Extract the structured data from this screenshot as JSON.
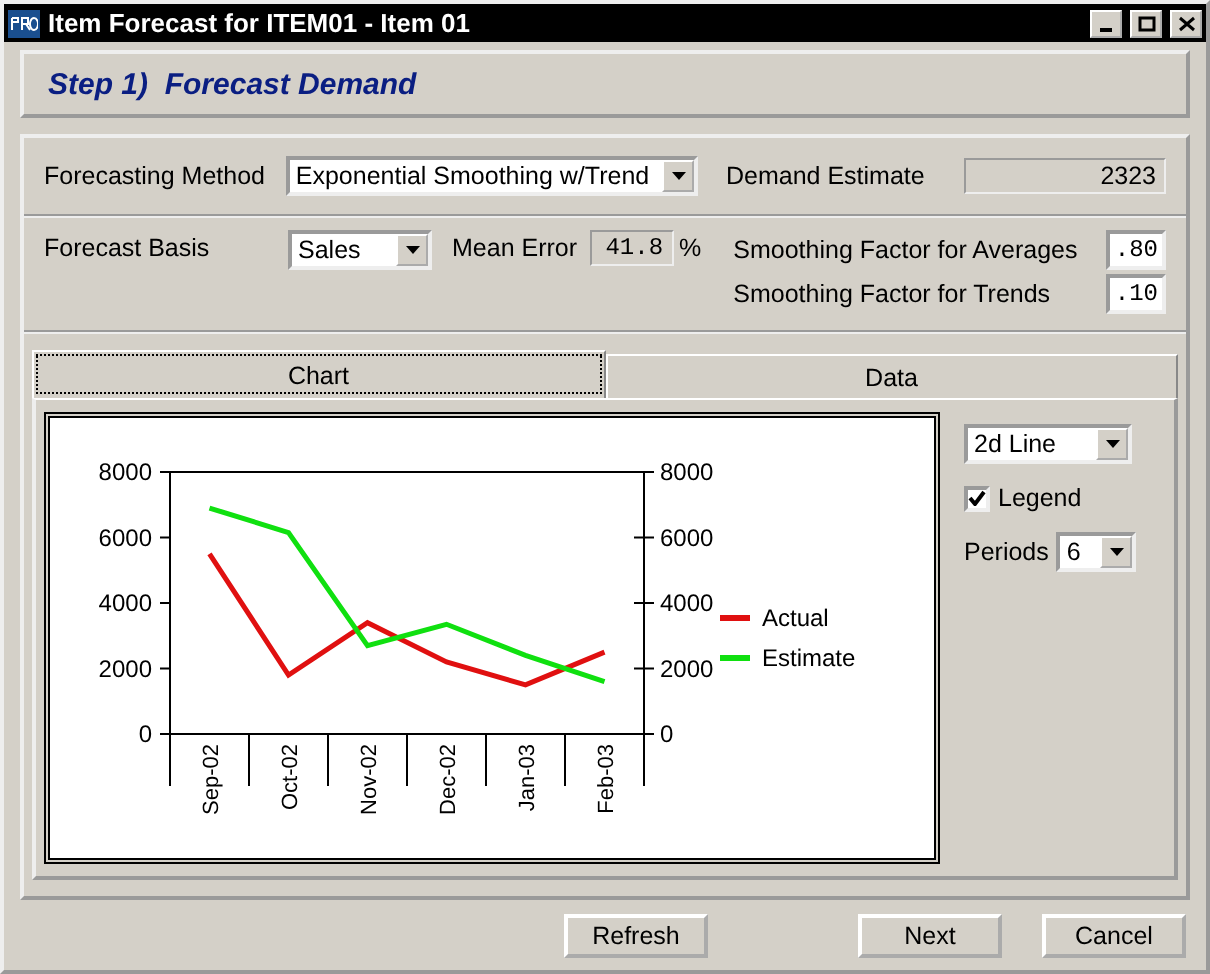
{
  "window": {
    "title": "Item Forecast for ITEM01 - Item 01"
  },
  "step": {
    "title": "Step 1)  Forecast Demand"
  },
  "method": {
    "label": "Forecasting Method",
    "value": "Exponential Smoothing w/Trend"
  },
  "demand_estimate": {
    "label": "Demand Estimate",
    "value": "2323"
  },
  "basis": {
    "label": "Forecast Basis",
    "value": "Sales"
  },
  "mean_error": {
    "label": "Mean Error",
    "value": "41.8",
    "unit": "%"
  },
  "smoothing": [
    {
      "label": "Smoothing Factor for Averages",
      "value": ".80"
    },
    {
      "label": "Smoothing Factor for Trends",
      "value": ".10"
    }
  ],
  "tabs": [
    {
      "label": "Chart",
      "selected": true
    },
    {
      "label": "Data",
      "selected": false
    }
  ],
  "chart_options": {
    "type": "2d Line",
    "legend": {
      "label": "Legend",
      "checked": true
    },
    "periods": {
      "label": "Periods",
      "value": "6"
    }
  },
  "chart": {
    "chart_data": {
      "type": "line",
      "categories": [
        "Sep-02",
        "Oct-02",
        "Nov-02",
        "Dec-02",
        "Jan-03",
        "Feb-03"
      ],
      "ylim": [
        0,
        8000
      ],
      "yticks": [
        0,
        2000,
        4000,
        6000,
        8000
      ],
      "y2lim": [
        0,
        8000
      ],
      "y2ticks": [
        0,
        2000,
        4000,
        6000,
        8000
      ],
      "legend": "right",
      "series": [
        {
          "name": "Actual",
          "color": "#e01010",
          "values": [
            5500,
            1800,
            3400,
            2200,
            1500,
            2500
          ]
        },
        {
          "name": "Estimate",
          "color": "#10e010",
          "values": [
            6900,
            6150,
            2700,
            3350,
            2400,
            1600
          ]
        }
      ]
    }
  },
  "buttons": [
    {
      "label": "Refresh",
      "kind": "left"
    },
    {
      "label": "Next",
      "kind": "right"
    },
    {
      "label": "Cancel",
      "kind": "right"
    }
  ]
}
